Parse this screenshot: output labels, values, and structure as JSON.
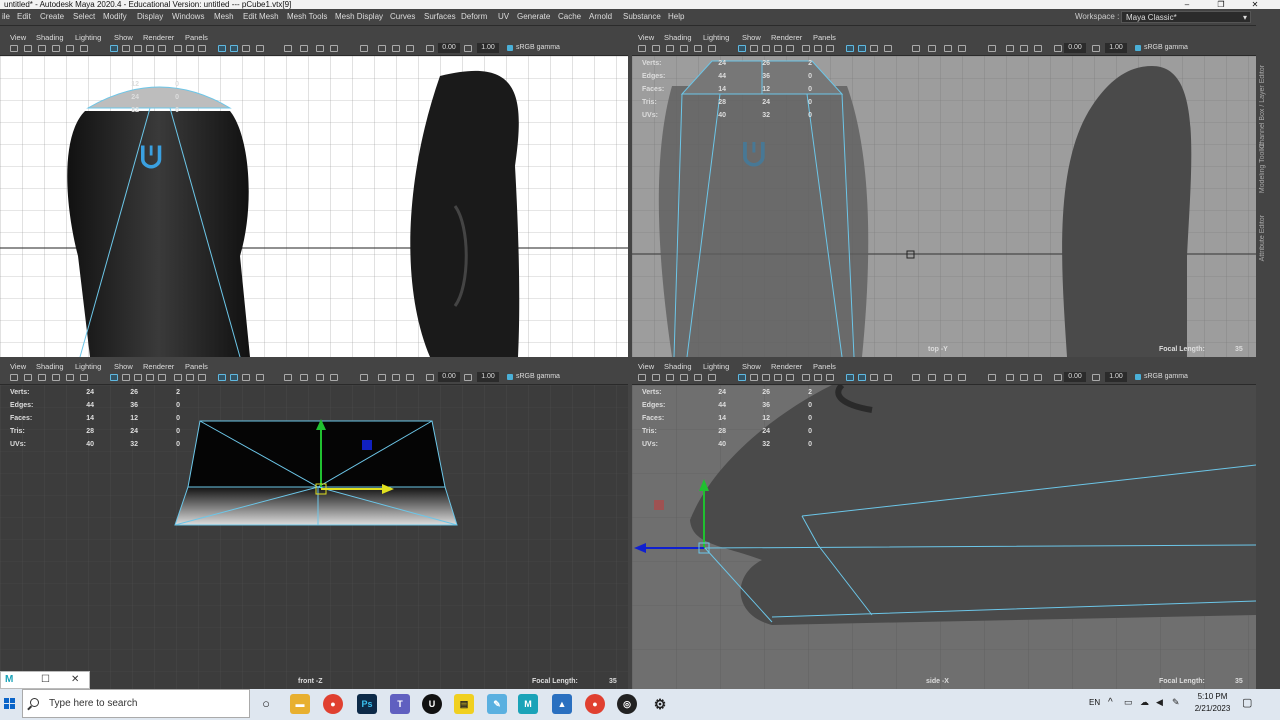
{
  "app": {
    "title": "untitled* - Autodesk Maya 2020.4 - Educational Version: untitled  ---  pCube1.vtx[9]",
    "window_controls": [
      "–",
      "❐",
      "✕"
    ]
  },
  "menubar": {
    "items": [
      "ile",
      "Edit",
      "Create",
      "Select",
      "Modify",
      "Display",
      "Windows",
      "Mesh",
      "Edit Mesh",
      "Mesh Tools",
      "Mesh Display",
      "Curves",
      "Surfaces",
      "Deform",
      "UV",
      "Generate",
      "Cache",
      "Arnold",
      "Substance",
      "Help"
    ],
    "workspace_label": "Workspace :",
    "workspace_value": "Maya Classic*"
  },
  "panel_menu": [
    "View",
    "Shading",
    "Lighting",
    "Show",
    "Renderer",
    "Panels"
  ],
  "panel_toolbar": {
    "value1": "0.00",
    "value2": "1.00",
    "colorspace": "sRGB gamma"
  },
  "hud": {
    "labels": [
      "Verts:",
      "Edges:",
      "Faces:",
      "Tris:",
      "UVs:"
    ],
    "col1": [
      "24",
      "44",
      "14",
      "28",
      "40"
    ],
    "col2": [
      "26",
      "36",
      "12",
      "24",
      "32"
    ],
    "col3": [
      "2",
      "0",
      "0",
      "0",
      "0"
    ]
  },
  "top_left_pane": {
    "hud_partial": {
      "col1": [
        "12",
        "24",
        "32"
      ],
      "col2": [
        "0",
        "0",
        "0"
      ]
    }
  },
  "views": {
    "top": {
      "camera": "top -Y",
      "focal_label": "Focal Length:",
      "focal_value": "35"
    },
    "front": {
      "camera": "front -Z",
      "focal_label": "Focal Length:",
      "focal_value": "35"
    },
    "side": {
      "camera": "side -X",
      "focal_label": "Focal Length:",
      "focal_value": "35"
    }
  },
  "sidestrip": [
    "Channel Box / Layer Editor",
    "Modeling Toolkit",
    "Attribute Editor"
  ],
  "taskbar": {
    "search_placeholder": "Type here to search",
    "language": "EN",
    "time": "5:10 PM",
    "date": "2/21/2023",
    "apps": [
      "Task View",
      "File Explorer",
      "Chrome",
      "Photoshop",
      "Teams",
      "Unreal",
      "Sticky Notes",
      "Notes",
      "Maya",
      "Photos",
      "Chrome",
      "OBS",
      "Settings"
    ]
  },
  "colors": {
    "accent": "#5fb8e0",
    "viewport_bg": "#3c3c3c",
    "wireframe": "#6cc6e8"
  }
}
